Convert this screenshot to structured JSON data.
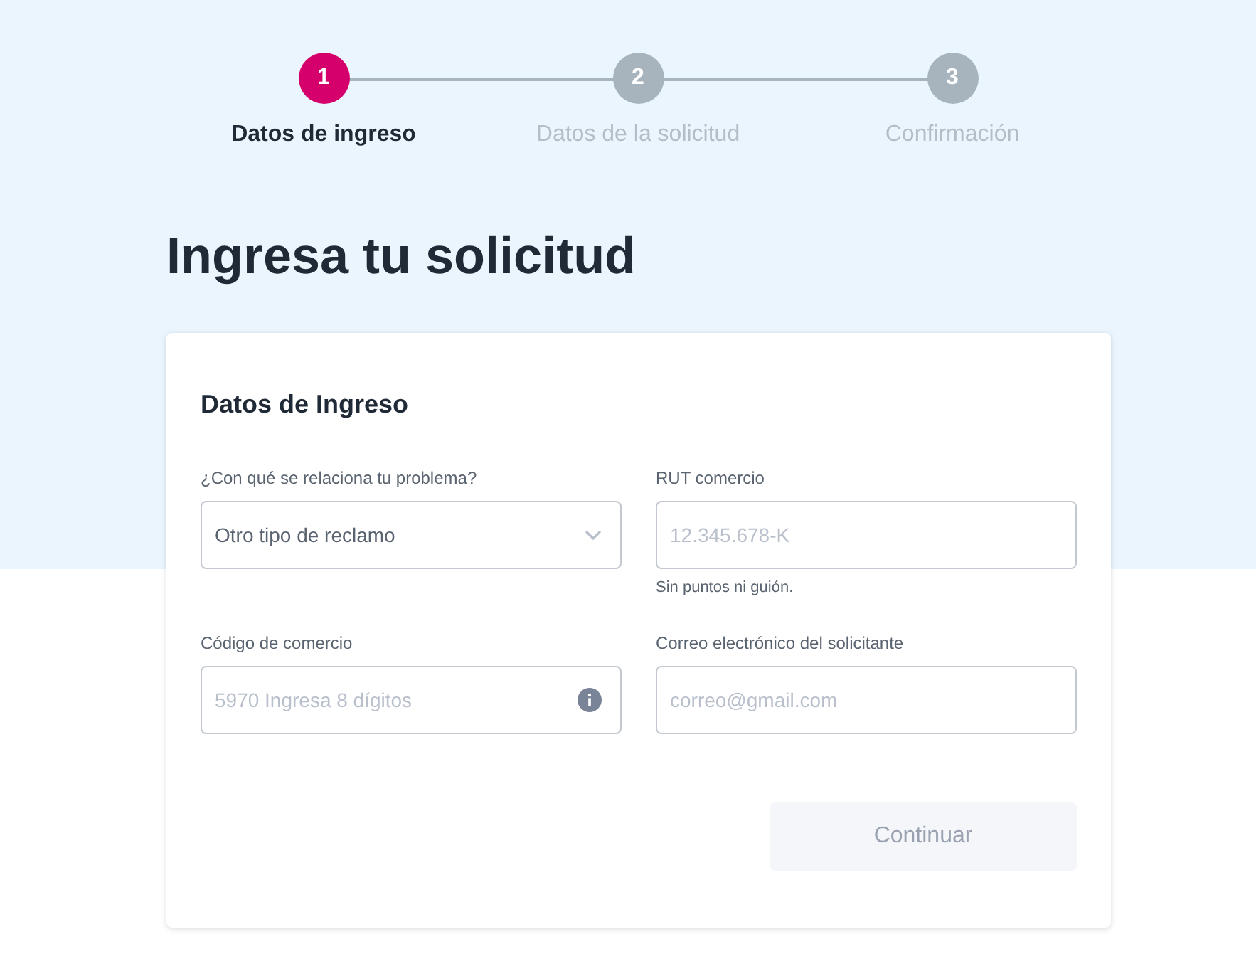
{
  "steps": [
    {
      "number": "1",
      "label": "Datos de ingreso",
      "selected": true
    },
    {
      "number": "2",
      "label": "Datos de la solicitud",
      "selected": false
    },
    {
      "number": "3",
      "label": "Confirmación",
      "selected": false
    }
  ],
  "title": "Ingresa tu solicitud",
  "card": {
    "heading": "Datos de Ingreso",
    "fields": [
      {
        "kind": "select",
        "label": "¿Con qué se relaciona tu problema?",
        "value": "Otro tipo de reclamo"
      },
      {
        "kind": "text",
        "label": "RUT comercio",
        "placeholder": "12.345.678-K",
        "helper": "Sin puntos ni guión."
      },
      {
        "kind": "info",
        "label": "Código de comercio",
        "placeholder": "5970 Ingresa 8 dígitos"
      },
      {
        "kind": "text",
        "label": "Correo electrónico del solicitante",
        "placeholder": "correo@gmail.com"
      }
    ],
    "button": {
      "label": "Continuar",
      "disabled": true
    }
  }
}
